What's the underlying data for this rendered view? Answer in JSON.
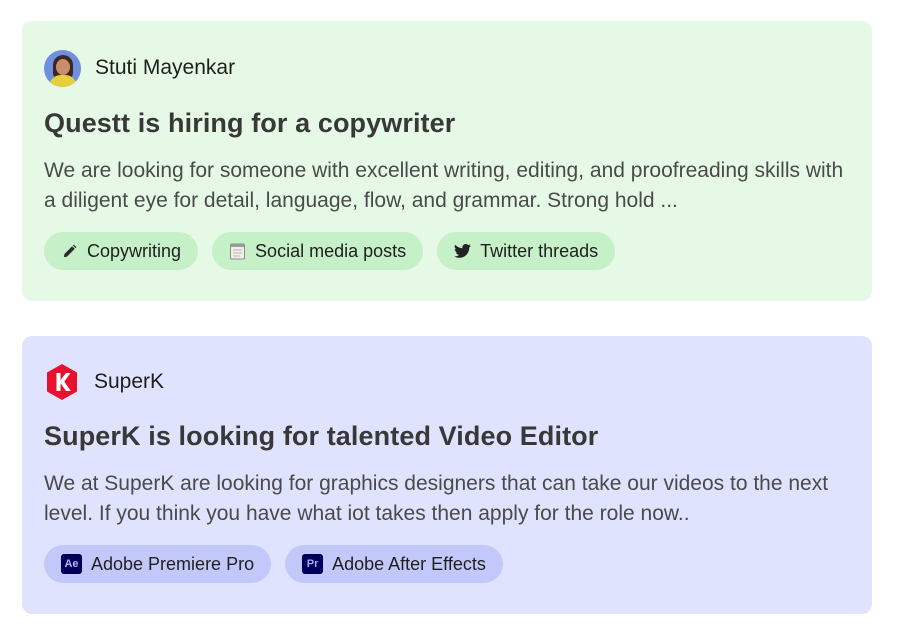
{
  "posts": [
    {
      "poster": {
        "name": "Stuti Mayenkar",
        "avatar": "person-avatar"
      },
      "title": "Questt is hiring for a copywriter",
      "description": "We are looking for someone with excellent writing, editing, and proofreading skills with a diligent eye for detail, language, flow, and grammar. Strong hold ...",
      "tags": [
        {
          "label": "Copywriting",
          "icon": "pencil-icon"
        },
        {
          "label": "Social media posts",
          "icon": "notepad-icon"
        },
        {
          "label": "Twitter threads",
          "icon": "twitter-icon"
        }
      ],
      "background": "#e6f9e6",
      "tag_background": "#c6f0c7"
    },
    {
      "poster": {
        "name": "SuperK",
        "avatar": "superk-logo-icon"
      },
      "title": "SuperK is looking for talented Video Editor",
      "description": "We at SuperK are looking for graphics designers that can take our videos to the next level. If you think you have what iot takes then apply for the role now..",
      "tags": [
        {
          "label": "Adobe Premiere Pro",
          "icon": "adobe-premiere-icon",
          "icon_text": "Ae"
        },
        {
          "label": "Adobe After Effects",
          "icon": "adobe-after-effects-icon",
          "icon_text": "Pr"
        }
      ],
      "background": "#e0e3fd",
      "tag_background": "#c3c8fb",
      "logo_color": "#e8112d"
    }
  ]
}
